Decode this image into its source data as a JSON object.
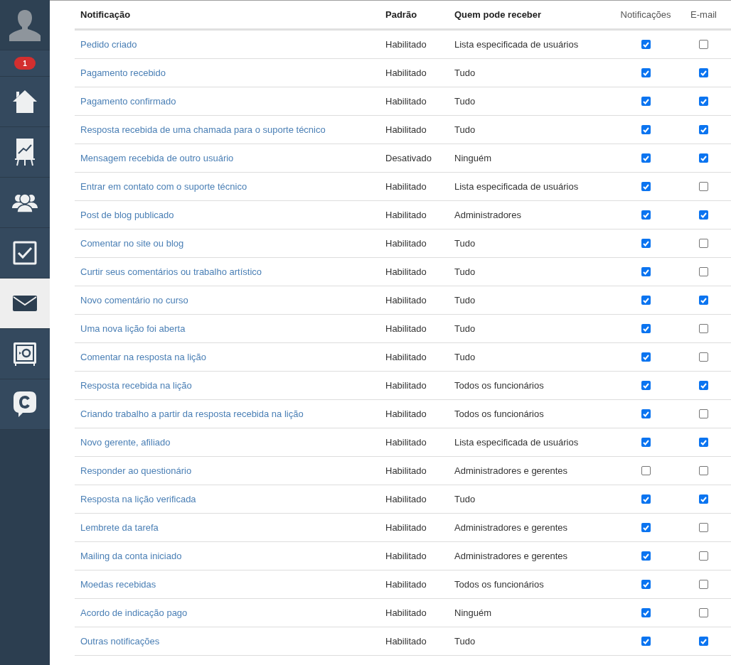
{
  "sidebar": {
    "items": [
      {
        "kind": "avatar",
        "selected": false
      },
      {
        "kind": "badge",
        "count": "1",
        "selected": false
      },
      {
        "kind": "home",
        "selected": false
      },
      {
        "kind": "chart",
        "selected": false
      },
      {
        "kind": "users",
        "selected": false
      },
      {
        "kind": "tasks",
        "selected": false
      },
      {
        "kind": "mail",
        "selected": true
      },
      {
        "kind": "safe",
        "selected": false
      },
      {
        "kind": "chat",
        "selected": false
      }
    ]
  },
  "table": {
    "columns": [
      "Notificação",
      "Padrão",
      "Quem pode receber",
      "Notificações",
      "E-mail"
    ],
    "rows": [
      {
        "name": "Pedido criado",
        "default": "Habilitado",
        "recipients": "Lista especificada de usuários",
        "notify": true,
        "email": false
      },
      {
        "name": "Pagamento recebido",
        "default": "Habilitado",
        "recipients": "Tudo",
        "notify": true,
        "email": true
      },
      {
        "name": "Pagamento confirmado",
        "default": "Habilitado",
        "recipients": "Tudo",
        "notify": true,
        "email": true
      },
      {
        "name": "Resposta recebida de uma chamada para o suporte técnico",
        "default": "Habilitado",
        "recipients": "Tudo",
        "notify": true,
        "email": true
      },
      {
        "name": "Mensagem recebida de outro usuário",
        "default": "Desativado",
        "recipients": "Ninguém",
        "notify": true,
        "email": true
      },
      {
        "name": "Entrar em contato com o suporte técnico",
        "default": "Habilitado",
        "recipients": "Lista especificada de usuários",
        "notify": true,
        "email": false
      },
      {
        "name": "Post de blog publicado",
        "default": "Habilitado",
        "recipients": "Administradores",
        "notify": true,
        "email": true
      },
      {
        "name": "Comentar no site ou blog",
        "default": "Habilitado",
        "recipients": "Tudo",
        "notify": true,
        "email": false
      },
      {
        "name": "Curtir seus comentários ou trabalho artístico",
        "default": "Habilitado",
        "recipients": "Tudo",
        "notify": true,
        "email": false
      },
      {
        "name": "Novo comentário no curso",
        "default": "Habilitado",
        "recipients": "Tudo",
        "notify": true,
        "email": true
      },
      {
        "name": "Uma nova lição foi aberta",
        "default": "Habilitado",
        "recipients": "Tudo",
        "notify": true,
        "email": false
      },
      {
        "name": "Comentar na resposta na lição",
        "default": "Habilitado",
        "recipients": "Tudo",
        "notify": true,
        "email": false
      },
      {
        "name": "Resposta recebida na lição",
        "default": "Habilitado",
        "recipients": "Todos os funcionários",
        "notify": true,
        "email": true
      },
      {
        "name": "Criando trabalho a partir da resposta recebida na lição",
        "default": "Habilitado",
        "recipients": "Todos os funcionários",
        "notify": true,
        "email": false
      },
      {
        "name": "Novo gerente, afiliado",
        "default": "Habilitado",
        "recipients": "Lista especificada de usuários",
        "notify": true,
        "email": true
      },
      {
        "name": "Responder ao questionário",
        "default": "Habilitado",
        "recipients": "Administradores e gerentes",
        "notify": false,
        "email": false
      },
      {
        "name": "Resposta na lição verificada",
        "default": "Habilitado",
        "recipients": "Tudo",
        "notify": true,
        "email": true
      },
      {
        "name": "Lembrete da tarefa",
        "default": "Habilitado",
        "recipients": "Administradores e gerentes",
        "notify": true,
        "email": false
      },
      {
        "name": "Mailing da conta iniciado",
        "default": "Habilitado",
        "recipients": "Administradores e gerentes",
        "notify": true,
        "email": false
      },
      {
        "name": "Moedas recebidas",
        "default": "Habilitado",
        "recipients": "Todos os funcionários",
        "notify": true,
        "email": false
      },
      {
        "name": "Acordo de indicação pago",
        "default": "Habilitado",
        "recipients": "Ninguém",
        "notify": true,
        "email": false
      },
      {
        "name": "Outras notificações",
        "default": "Habilitado",
        "recipients": "Tudo",
        "notify": true,
        "email": true
      }
    ]
  }
}
